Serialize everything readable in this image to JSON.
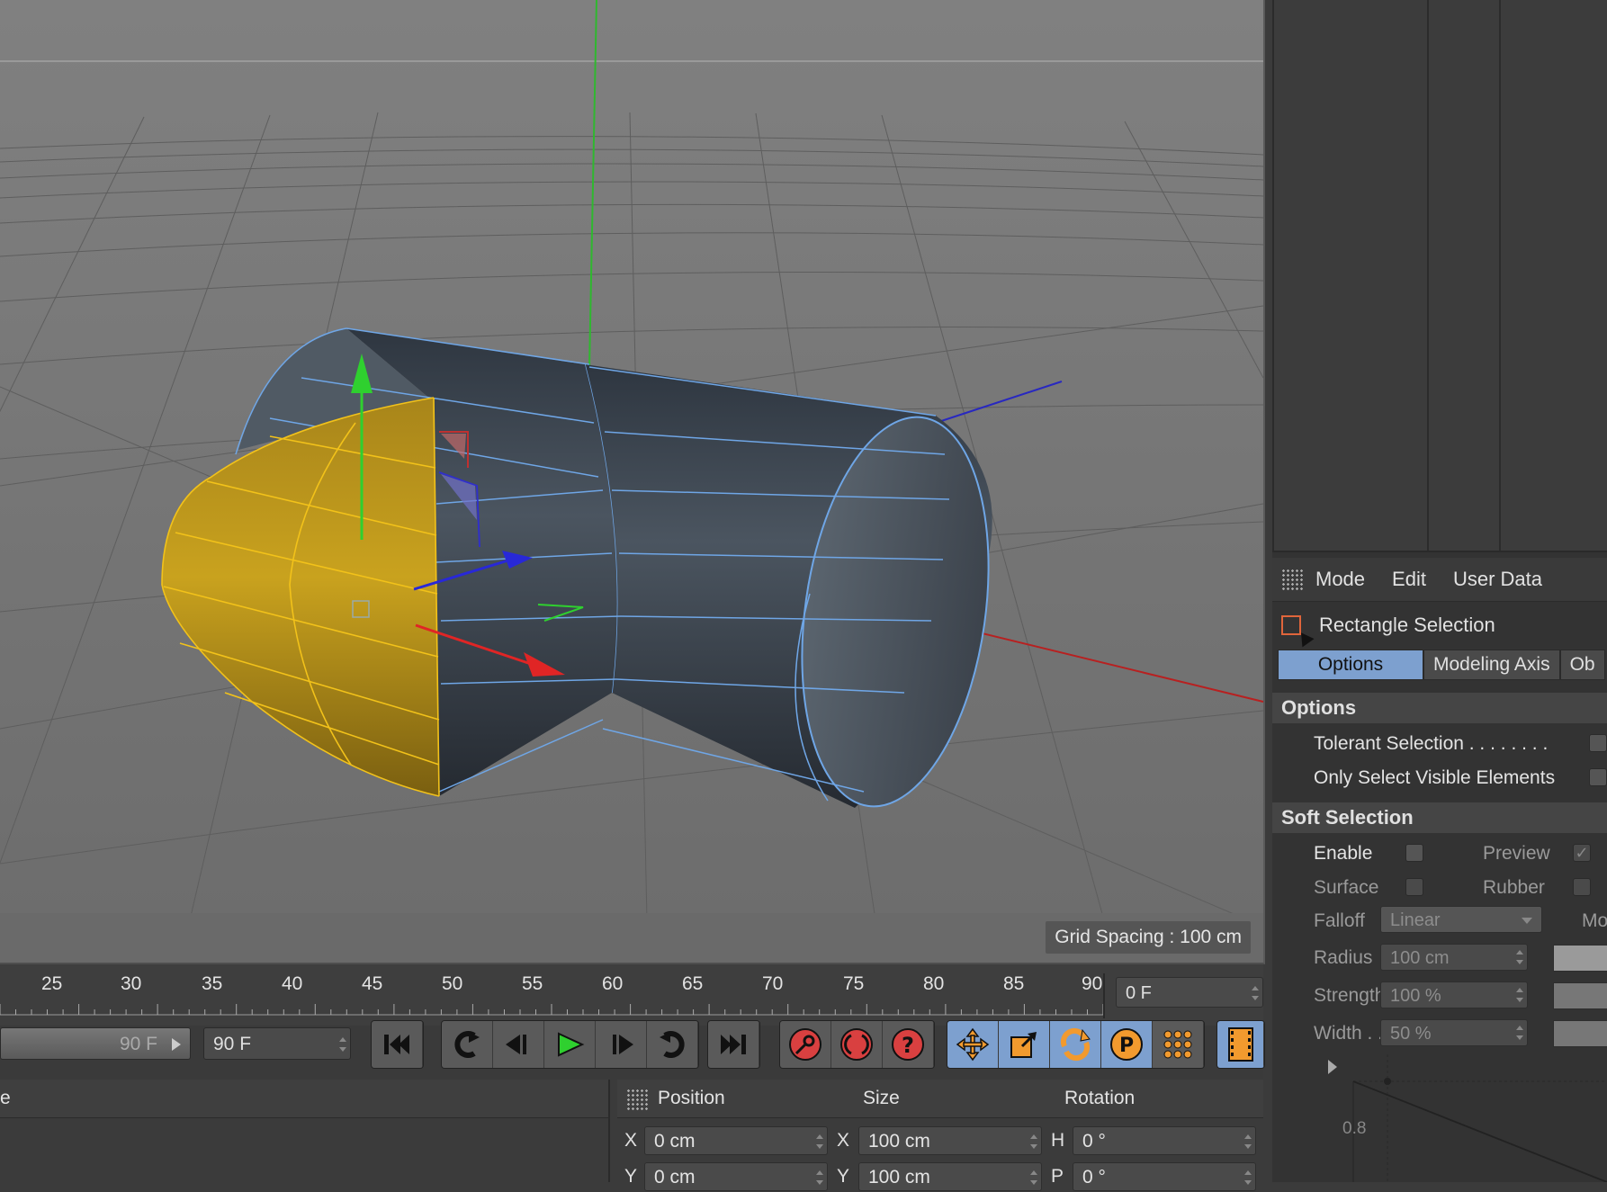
{
  "viewport": {
    "grid_spacing_label": "Grid Spacing : 100 cm"
  },
  "attributes": {
    "menu": [
      "Mode",
      "Edit",
      "User Data"
    ],
    "tool_name": "Rectangle Selection",
    "tabs": [
      "Options",
      "Modeling Axis",
      "Ob"
    ],
    "options_section": {
      "title": "Options",
      "tolerant_selection": "Tolerant Selection . . . . . . . .",
      "only_visible": "Only Select Visible Elements"
    },
    "soft_selection": {
      "title": "Soft Selection",
      "enable": "Enable",
      "preview": "Preview",
      "preview_check": "✓",
      "surface": "Surface",
      "rubber": "Rubber",
      "falloff": "Falloff",
      "falloff_value": "Linear",
      "falloff_extra": "Mo",
      "radius": "Radius",
      "radius_value": "100 cm",
      "strength": "Strength",
      "strength_value": "100 %",
      "width": "Width . .",
      "width_value": "50 %",
      "graph_value": "0.8"
    }
  },
  "timeline": {
    "ticks": [
      "25",
      "30",
      "35",
      "40",
      "45",
      "50",
      "55",
      "60",
      "65",
      "70",
      "75",
      "80",
      "85",
      "90"
    ],
    "current_frame": "0 F",
    "end_slider_value": "90 F",
    "end_field_value": "90 F"
  },
  "bottom_left": {
    "header_fragment": "e"
  },
  "coordinates": {
    "headers": {
      "position": "Position",
      "size": "Size",
      "rotation": "Rotation"
    },
    "rows": [
      {
        "pos_axis": "X",
        "pos": "0 cm",
        "size_axis": "X",
        "size": "100 cm",
        "rot_axis": "H",
        "rot": "0 °"
      },
      {
        "pos_axis": "Y",
        "pos": "0 cm",
        "size_axis": "Y",
        "size": "100 cm",
        "rot_axis": "P",
        "rot": "0 °"
      }
    ]
  },
  "icons": {
    "transport": [
      "go-to-start-icon",
      "prev-key-icon",
      "prev-frame-icon",
      "play-icon",
      "next-frame-icon",
      "next-key-icon",
      "go-to-end-icon"
    ],
    "record": [
      "record-key-icon",
      "autokey-icon",
      "keyframe-help-icon"
    ],
    "key_tracks": [
      "move-track-icon",
      "scale-track-icon",
      "rotate-track-icon",
      "param-track-icon",
      "pla-track-icon"
    ],
    "misc": [
      "film-strip-icon"
    ]
  },
  "colors": {
    "selection_yellow": "#c9a21e",
    "edge_blue": "#6fa6e6",
    "active_tab": "#7da0cf",
    "record_red": "#d94040",
    "accent_orange": "#f29a2e"
  }
}
